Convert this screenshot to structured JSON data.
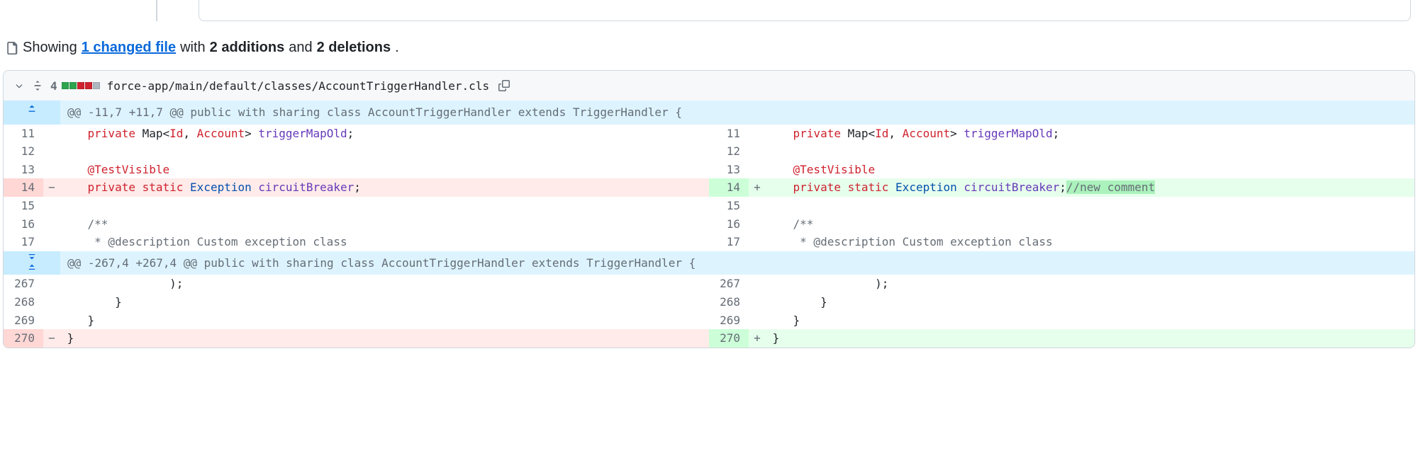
{
  "summary": {
    "showing": "Showing",
    "link": "1 changed file",
    "with": " with ",
    "additions": "2 additions",
    "and": " and ",
    "deletions": "2 deletions"
  },
  "file": {
    "path": "force-app/main/default/classes/AccountTriggerHandler.cls",
    "diffstat_count": "4"
  },
  "hunks": {
    "h1": "@@ -11,7 +11,7 @@ public with sharing class AccountTriggerHandler extends TriggerHandler {",
    "h2": "@@ -267,4 +267,4 @@ public with sharing class AccountTriggerHandler extends TriggerHandler {"
  },
  "rows": {
    "r11_l": "11",
    "r11_r": "11",
    "r12_l": "12",
    "r12_r": "12",
    "r13_l": "13",
    "r13_r": "13",
    "r14_l": "14",
    "r14_r": "14",
    "r15_l": "15",
    "r15_r": "15",
    "r16_l": "16",
    "r16_r": "16",
    "r17_l": "17",
    "r17_r": "17",
    "r267_l": "267",
    "r267_r": "267",
    "r268_l": "268",
    "r268_r": "268",
    "r269_l": "269",
    "r269_r": "269",
    "r270_l": "270",
    "r270_r": "270"
  },
  "signs": {
    "minus": "−",
    "plus": "+"
  },
  "code": {
    "l11_kw": "private",
    "l11_map": " Map<",
    "l11_id": "Id",
    "l11_sep": ", ",
    "l11_acc": "Account",
    "l11_gt": "> ",
    "l11_var": "triggerMapOld",
    "l11_semi": ";",
    "l13_anno": "@TestVisible",
    "l14_priv": "private",
    "l14_sp1": " ",
    "l14_static": "static",
    "l14_sp2": " ",
    "l14_exc": "Exception",
    "l14_sp3": " ",
    "l14_cb": "circuitBreaker",
    "l14_semi": ";",
    "l14_comment": "//new comment",
    "l16_open": "/**",
    "l17_desc": " * @description Custom exception class",
    "l267_close": ");",
    "l268_brace": "}",
    "l269_brace": "}",
    "l270_brace": "}"
  },
  "indent": {
    "i4": "    ",
    "i8": "        ",
    "i12": "            ",
    "i16": "                ",
    "i2": " "
  }
}
